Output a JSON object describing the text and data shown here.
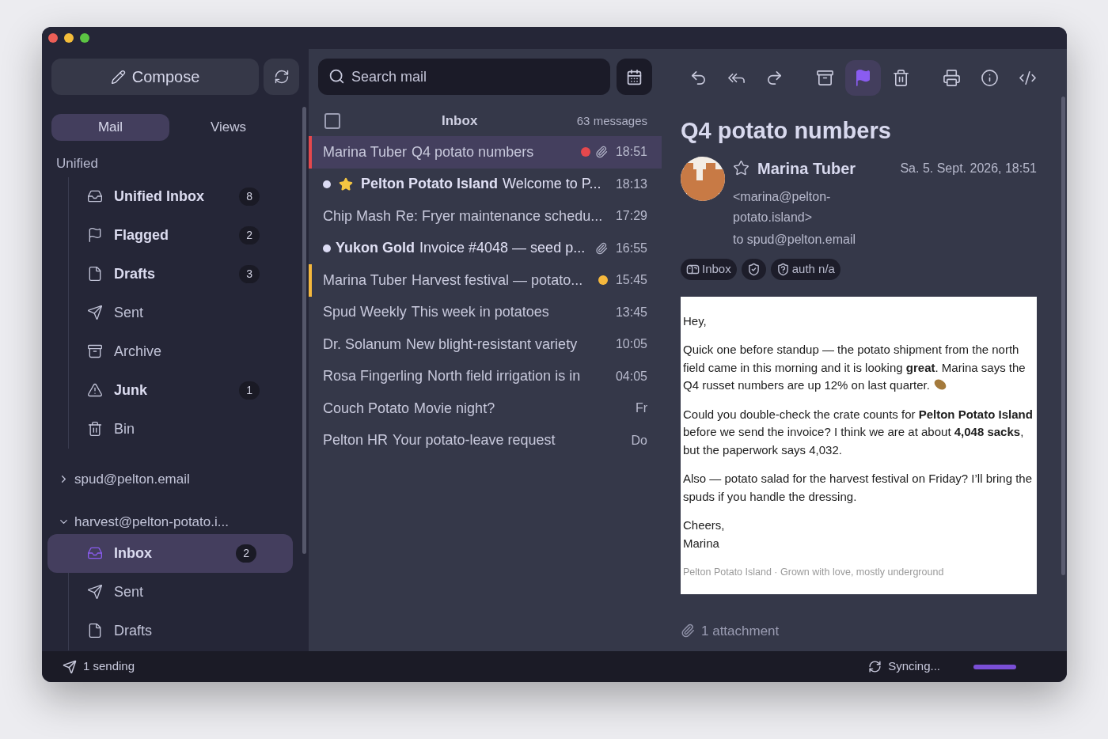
{
  "sidebar": {
    "compose_label": "Compose",
    "tabs": [
      {
        "label": "Mail",
        "selected": true
      },
      {
        "label": "Views",
        "selected": false
      }
    ],
    "unified": {
      "title": "Unified",
      "items": [
        {
          "kind": "inbox",
          "label": "Unified Inbox",
          "count": "8",
          "unread": true,
          "selected": false
        },
        {
          "kind": "flag",
          "label": "Flagged",
          "count": "2",
          "unread": true,
          "selected": false
        },
        {
          "kind": "draft",
          "label": "Drafts",
          "count": "3",
          "unread": true,
          "selected": false
        },
        {
          "kind": "sent",
          "label": "Sent",
          "unread": false,
          "selected": false
        },
        {
          "kind": "archive",
          "label": "Archive",
          "unread": false,
          "selected": false
        },
        {
          "kind": "junk",
          "label": "Junk",
          "count": "1",
          "unread": true,
          "selected": false
        },
        {
          "kind": "bin",
          "label": "Bin",
          "unread": false,
          "selected": false
        }
      ]
    },
    "accounts": [
      {
        "label": "spud@pelton.email",
        "expanded": false
      },
      {
        "label": "harvest@pelton-potato.i...",
        "expanded": true,
        "children": [
          {
            "kind": "inbox",
            "label": "Inbox",
            "count": "2",
            "unread": true,
            "selected": true
          },
          {
            "kind": "sent",
            "label": "Sent",
            "unread": false,
            "selected": false
          },
          {
            "kind": "draft",
            "label": "Drafts",
            "unread": false,
            "selected": false
          }
        ]
      }
    ]
  },
  "message_list": {
    "search": {
      "placeholder": "Search mail"
    },
    "title": "Inbox",
    "count": "63 messages",
    "select_all": {
      "checked": false
    },
    "rows": [
      {
        "sender": "Marina Tuber",
        "subject": "Q4 potato numbers",
        "time": "18:51",
        "selected": true,
        "unread": false,
        "starred": false,
        "attachment": true,
        "color": "#e5484d"
      },
      {
        "sender": "Pelton Potato Island",
        "subject": "Welcome to P...",
        "time": "18:13",
        "selected": false,
        "unread": true,
        "starred": true,
        "attachment": false
      },
      {
        "sender": "Chip Mash",
        "subject": "Re: Fryer maintenance schedu...",
        "time": "17:29",
        "selected": false,
        "unread": false,
        "starred": false,
        "attachment": false
      },
      {
        "sender": "Yukon Gold",
        "subject": "Invoice #4048 — seed p...",
        "time": "16:55",
        "selected": false,
        "unread": true,
        "starred": false,
        "attachment": true
      },
      {
        "sender": "Marina Tuber",
        "subject": "Harvest festival — potato...",
        "time": "15:45",
        "selected": false,
        "unread": false,
        "starred": false,
        "attachment": false,
        "color": "#f5b83d"
      },
      {
        "sender": "Spud Weekly",
        "subject": "This week in potatoes",
        "time": "13:45",
        "selected": false,
        "unread": false,
        "starred": false,
        "attachment": false
      },
      {
        "sender": "Dr. Solanum",
        "subject": "New blight-resistant variety",
        "time": "10:05",
        "selected": false,
        "unread": false,
        "starred": false,
        "attachment": false
      },
      {
        "sender": "Rosa Fingerling",
        "subject": "North field irrigation is in",
        "time": "04:05",
        "selected": false,
        "unread": false,
        "starred": false,
        "attachment": false
      },
      {
        "sender": "Couch Potato",
        "subject": "Movie night?",
        "time": "Fr",
        "selected": false,
        "unread": false,
        "starred": false,
        "attachment": false
      },
      {
        "sender": "Pelton HR",
        "subject": "Your potato-leave request",
        "time": "Do",
        "selected": false,
        "unread": false,
        "starred": false,
        "attachment": false
      }
    ]
  },
  "reader": {
    "toolbar": [
      {
        "kind": "reply",
        "selected": false
      },
      {
        "kind": "reply-all",
        "selected": false
      },
      {
        "kind": "forward",
        "selected": false
      },
      {
        "kind": "archive",
        "selected": false
      },
      {
        "kind": "flag",
        "selected": true
      },
      {
        "kind": "delete",
        "selected": false
      },
      {
        "kind": "print",
        "selected": false
      },
      {
        "kind": "info",
        "selected": false
      },
      {
        "kind": "source",
        "selected": false
      }
    ],
    "subject": "Q4 potato numbers",
    "sender": "Marina Tuber",
    "starred": false,
    "address": "<marina@pelton-potato.island>",
    "to": "to spud@pelton.email",
    "date": "Sa. 5. Sept. 2026, 18:51",
    "tags": [
      {
        "kind": "folder",
        "label": "Inbox"
      },
      {
        "kind": "shield-check"
      },
      {
        "kind": "shield-question",
        "label": "auth n/a"
      }
    ],
    "body": [
      {
        "kind": "text",
        "text": "Hey,"
      },
      {
        "kind": "potato",
        "text": "Quick one before standup — the potato shipment from the north field came in this morning and it is looking **great**. Marina says the Q4 russet numbers are up 12% on last quarter."
      },
      {
        "kind": "text",
        "text": "Could you double-check the crate counts for **Pelton Potato Island** before we send the invoice? I think we are at about **4,048 sacks**, but the paperwork says 4,032."
      },
      {
        "kind": "text",
        "text": "Also — potato salad for the harvest festival on Friday? I’ll bring the spuds if you handle the dressing."
      },
      {
        "kind": "lines",
        "lines": [
          "Cheers,",
          "Marina"
        ]
      },
      {
        "kind": "footer",
        "text": "Pelton Potato Island · Grown with love, mostly underground"
      }
    ],
    "attachments": "1 attachment"
  },
  "status_bar": {
    "sending": "1 sending",
    "sync": {
      "label": "Syncing...",
      "level": 1
    }
  }
}
